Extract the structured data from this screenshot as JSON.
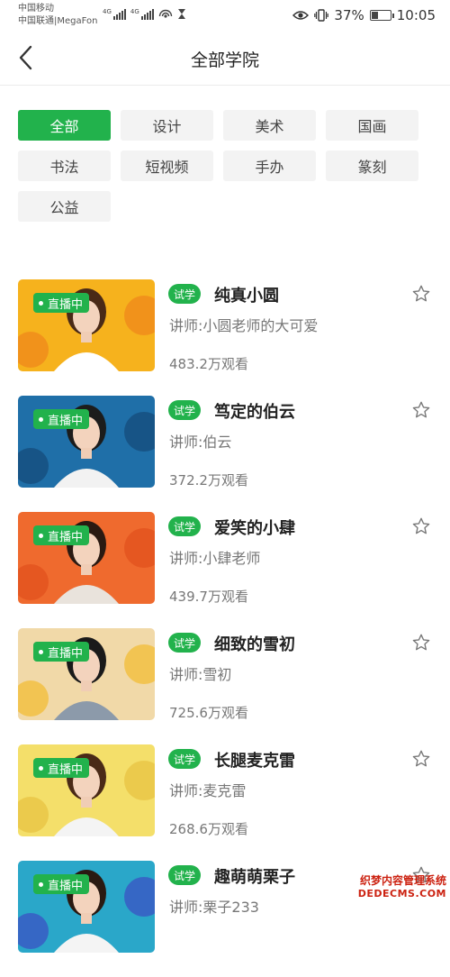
{
  "status_bar": {
    "carrier_1": "中国移动",
    "carrier_2": "中国联通|MegaFon",
    "network_1": "4G",
    "network_2": "4G",
    "battery_percent": "37%",
    "battery_level": 0.37,
    "time": "10:05"
  },
  "nav": {
    "title": "全部学院"
  },
  "categories": [
    {
      "label": "全部",
      "active": true
    },
    {
      "label": "设计"
    },
    {
      "label": "美术"
    },
    {
      "label": "国画"
    },
    {
      "label": "书法"
    },
    {
      "label": "短视频"
    },
    {
      "label": "手办"
    },
    {
      "label": "篆刻"
    },
    {
      "label": "公益"
    }
  ],
  "courses": [
    {
      "live": "直播中",
      "tag": "试学",
      "name": "纯真小圆",
      "teacher": "讲师:小圆老师的大可爱",
      "views": "483.2万观看",
      "bg": "#f6b21d",
      "bg2": "#f08a1c",
      "hair": "#4a2a17",
      "shirt": "#ffffff"
    },
    {
      "live": "直播中",
      "tag": "试学",
      "name": "笃定的伯云",
      "teacher": "讲师:伯云",
      "views": "372.2万观看",
      "bg": "#1f6fa8",
      "bg2": "#154d7d",
      "hair": "#1c1c1c",
      "shirt": "#f2f2f2"
    },
    {
      "live": "直播中",
      "tag": "试学",
      "name": "爱笑的小肆",
      "teacher": "讲师:小肆老师",
      "views": "439.7万观看",
      "bg": "#ef6a2e",
      "bg2": "#e2531e",
      "hair": "#2a1a12",
      "shirt": "#e9e3dc"
    },
    {
      "live": "直播中",
      "tag": "试学",
      "name": "细致的雪初",
      "teacher": "讲师:雪初",
      "views": "725.6万观看",
      "bg": "#f1d9a8",
      "bg2": "#f3be3c",
      "hair": "#1a1a1a",
      "shirt": "#8c9aaa"
    },
    {
      "live": "直播中",
      "tag": "试学",
      "name": "长腿麦克雷",
      "teacher": "讲师:麦克雷",
      "views": "268.6万观看",
      "bg": "#f4df6a",
      "bg2": "#e9c445",
      "hair": "#4a2a17",
      "shirt": "#f4f4f4"
    },
    {
      "live": "直播中",
      "tag": "试学",
      "name": "趣萌萌栗子",
      "teacher": "讲师:栗子233",
      "views": "",
      "bg": "#2aa7c9",
      "bg2": "#3a58c4",
      "hair": "#2a1a12",
      "shirt": "#f4f4f4"
    }
  ],
  "watermark": {
    "line1": "织梦内容管理系统",
    "line2": "DEDECMS.COM"
  },
  "colors": {
    "accent": "#22b24c"
  }
}
